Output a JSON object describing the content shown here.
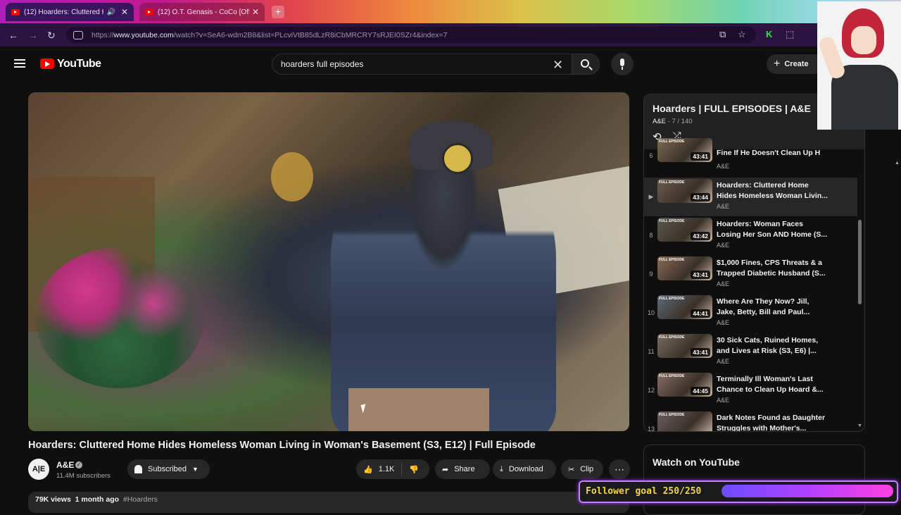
{
  "browser": {
    "tabs": [
      {
        "title": "(12) Hoarders: Cluttered Ho",
        "active": true
      },
      {
        "title": "(12) O.T. Genasis - CoCo [Offici",
        "active": false
      }
    ],
    "url_prefix": "https://",
    "url_host": "www.youtube.com",
    "url_path": "/watch?v=SeA6-wdm2B8&list=PLcviVtB85dLzR8iCbMRCRY7sRJEI0SZr4&index=7"
  },
  "header": {
    "logo_text": "YouTube",
    "search_value": "hoarders full episodes",
    "create_label": "Create"
  },
  "video": {
    "title": "Hoarders: Cluttered Home Hides Homeless Woman Living in Woman's Basement (S3, E12) | Full Episode",
    "channel": "A&E",
    "channel_avatar": "A|E",
    "subscribers": "11.4M subscribers",
    "subscribed_label": "Subscribed",
    "likes": "1.1K",
    "share_label": "Share",
    "download_label": "Download",
    "clip_label": "Clip",
    "views": "79K views",
    "age": "1 month ago",
    "hashtag": "#Hoarders"
  },
  "playlist": {
    "title": "Hoarders | FULL EPISODES | A&E",
    "owner": "A&E",
    "position": "- 7 / 140",
    "items": [
      {
        "index": "6",
        "title": "Fine If He Doesn't Clean Up H",
        "channel": "A&E",
        "duration": "43:41",
        "current": false
      },
      {
        "index": "▶",
        "title": "Hoarders: Cluttered Home Hides Homeless Woman Livin...",
        "channel": "A&E",
        "duration": "43:44",
        "current": true
      },
      {
        "index": "8",
        "title": "Hoarders: Woman Faces Losing Her Son AND Home (S...",
        "channel": "A&E",
        "duration": "43:42",
        "current": false
      },
      {
        "index": "9",
        "title": "$1,000 Fines, CPS Threats & a Trapped Diabetic Husband (S...",
        "channel": "A&E",
        "duration": "43:41",
        "current": false
      },
      {
        "index": "10",
        "title": "Where Are They Now? Jill, Jake, Betty, Bill and Paul...",
        "channel": "A&E",
        "duration": "44:41",
        "current": false
      },
      {
        "index": "11",
        "title": "30 Sick Cats, Ruined Homes, and Lives at Risk (S3, E6) |...",
        "channel": "A&E",
        "duration": "43:41",
        "current": false
      },
      {
        "index": "12",
        "title": "Terminally Ill Woman's Last Chance to Clean Up Hoard &...",
        "channel": "A&E",
        "duration": "44:45",
        "current": false
      },
      {
        "index": "13",
        "title": "Dark Notes Found as Daughter Struggles with Mother's...",
        "channel": "",
        "duration": "",
        "current": false
      }
    ],
    "thumb_label": "FULL EPISODE"
  },
  "watch_on_youtube": "Watch on YouTube",
  "overlay": {
    "follower_goal": "Follower goal 250/250",
    "progress": 1.0
  },
  "colors": {
    "accent": "#ff0000",
    "background": "#0f0f0f",
    "goal_text": "#f2d44a"
  }
}
